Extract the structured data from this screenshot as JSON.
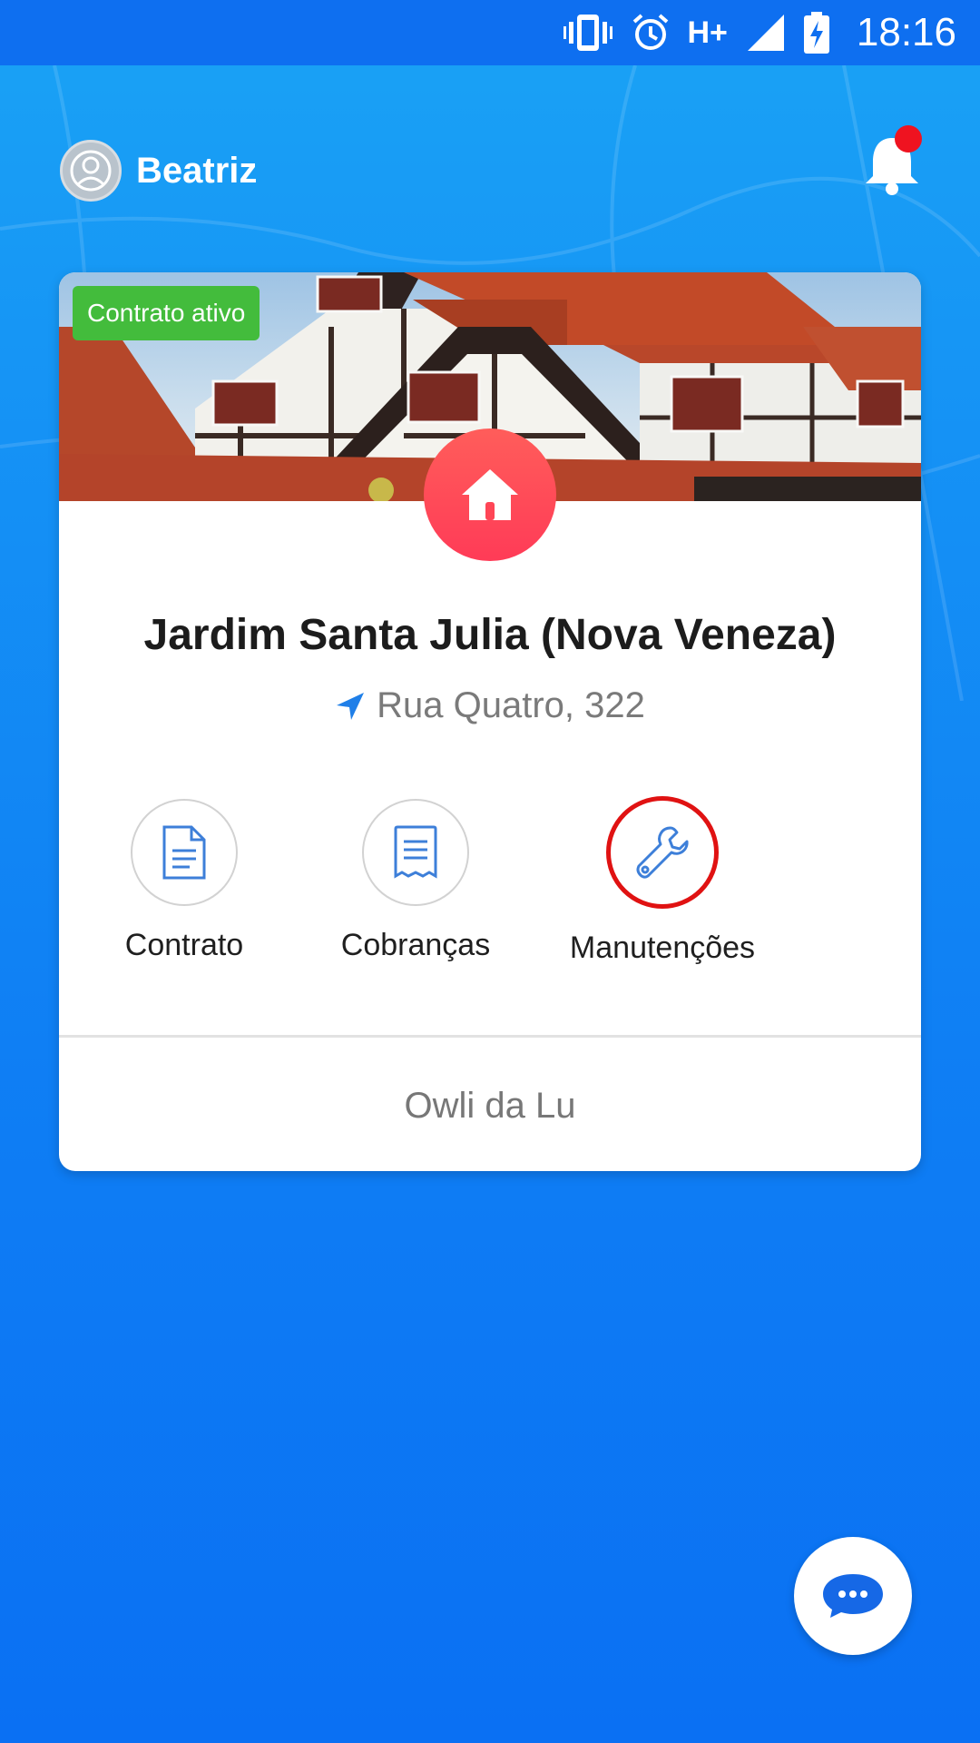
{
  "status_bar": {
    "network": "H+",
    "time": "18:16"
  },
  "header": {
    "user_name": "Beatriz"
  },
  "card": {
    "badge": "Contrato ativo",
    "title": "Jardim Santa Julia (Nova Veneza)",
    "address": "Rua Quatro, 322",
    "actions": [
      {
        "label": "Contrato",
        "icon": "document-icon"
      },
      {
        "label": "Cobranças",
        "icon": "receipt-icon"
      },
      {
        "label": "Manutenções",
        "icon": "wrench-icon"
      }
    ],
    "footer": "Owli da Lu"
  },
  "colors": {
    "primary_blue": "#0f7ff4",
    "badge_green": "#43bc3c",
    "home_fab_red": "#ff4a58",
    "highlight_ring": "#e01212",
    "notification_dot": "#ef1320"
  }
}
